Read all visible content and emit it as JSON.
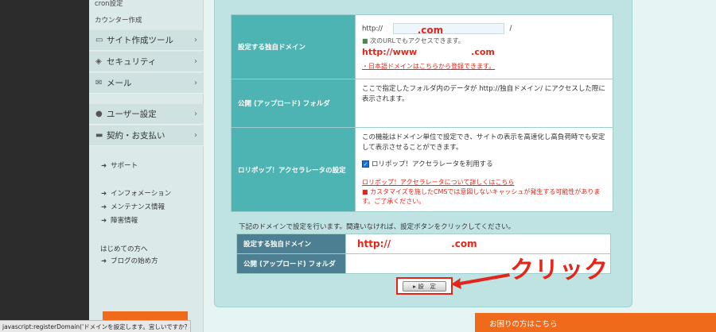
{
  "sidebar": {
    "top_links": [
      "cron設定",
      "カウンター作成"
    ],
    "items": [
      {
        "icon": "laptop-icon",
        "label": "サイト作成ツール"
      },
      {
        "icon": "shield-icon",
        "label": "セキュリティ"
      },
      {
        "icon": "mail-icon",
        "label": "メール"
      },
      {
        "icon": "user-icon",
        "label": "ユーザー設定"
      },
      {
        "icon": "card-icon",
        "label": "契約・お支払い"
      }
    ],
    "sub_links_1": [
      "サポート"
    ],
    "sub_links_2": [
      "インフォメーション",
      "メンテナンス情報",
      "障害情報"
    ],
    "beginner_label": "はじめての方へ",
    "sub_links_3": [
      "ブログの始め方"
    ]
  },
  "form": {
    "domain_label": "設定する独自ドメイン",
    "http_prefix": "http://",
    "domain_suffix": ".com",
    "slash": "/",
    "access_note": "次のURLでもアクセスできます。",
    "access_url_prefix": "http://www",
    "access_url_suffix": ".com",
    "jp_domain_link": "・日本語ドメインはこちらから登録できます。",
    "folder_label": "公開 (アップロード) フォルダ",
    "folder_desc": "ここで指定したフォルダ内のデータが http://独自ドメイン/ にアクセスした際に表示されます。",
    "accel_label": "ロリポップ！アクセラレータの設定",
    "accel_desc": "この機能はドメイン単位で設定でき、サイトの表示を高速化し高負荷時でも安定して表示させることができます。",
    "accel_checkbox": "ロリポップ！アクセラレータを利用する",
    "accel_link": "ロリポップ！アクセラレータについて詳しくはこちら",
    "accel_warning": "カスタマイズを施したCMSでは意図しないキャッシュが発生する可能性があります。ご了承ください。"
  },
  "confirm": {
    "text": "下記のドメインで設定を行います。間違いなければ、設定ボタンをクリックしてください。",
    "domain_label": "設定する独自ドメイン",
    "domain_prefix": "http://",
    "domain_suffix": ".com",
    "folder_label": "公開 (アップロード) フォルダ",
    "set_button": "▸ 設　定"
  },
  "annotation": {
    "click_text": "クリック"
  },
  "help_bar": "お困りの方はこちら",
  "status_bar": "javascript:registerDomain('ドメインを設定します。宜しいですか？')"
}
